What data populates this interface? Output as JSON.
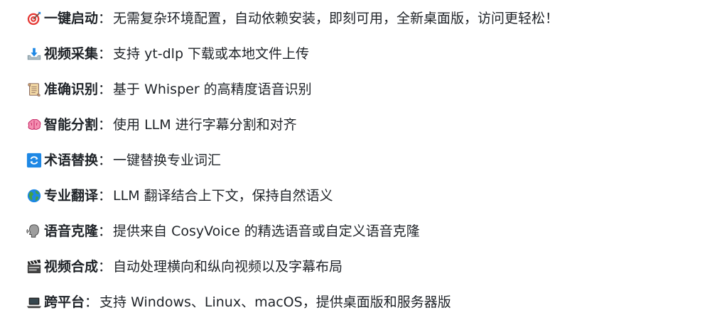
{
  "features": [
    {
      "icon": "direct-hit-target-icon",
      "title": "一键启动",
      "separator": "：",
      "description": "无需复杂环境配置，自动依赖安装，即刻可用，全新桌面版，访问更轻松！"
    },
    {
      "icon": "inbox-tray-download-icon",
      "title": "视频采集",
      "separator": "：",
      "description": "支持 yt-dlp 下载或本地文件上传"
    },
    {
      "icon": "scroll-icon",
      "title": "准确识别",
      "separator": "：",
      "description": "基于 Whisper 的高精度语音识别"
    },
    {
      "icon": "brain-icon",
      "title": "智能分割",
      "separator": "：",
      "description": "使用 LLM 进行字幕分割和对齐"
    },
    {
      "icon": "arrows-counterclockwise-icon",
      "title": "术语替换",
      "separator": "：",
      "description": "一键替换专业词汇"
    },
    {
      "icon": "globe-americas-icon",
      "title": "专业翻译",
      "separator": "：",
      "description": "LLM 翻译结合上下文，保持自然语义"
    },
    {
      "icon": "speaking-head-icon",
      "title": "语音克隆",
      "separator": "：",
      "description": "提供来自 CosyVoice 的精选语音或自定义语音克隆"
    },
    {
      "icon": "clapper-board-icon",
      "title": "视频合成",
      "separator": "：",
      "description": "自动处理横向和纵向视频以及字幕布局"
    },
    {
      "icon": "laptop-icon",
      "title": "跨平台",
      "separator": "：",
      "description": "支持 Windows、Linux、macOS，提供桌面版和服务器版"
    }
  ]
}
